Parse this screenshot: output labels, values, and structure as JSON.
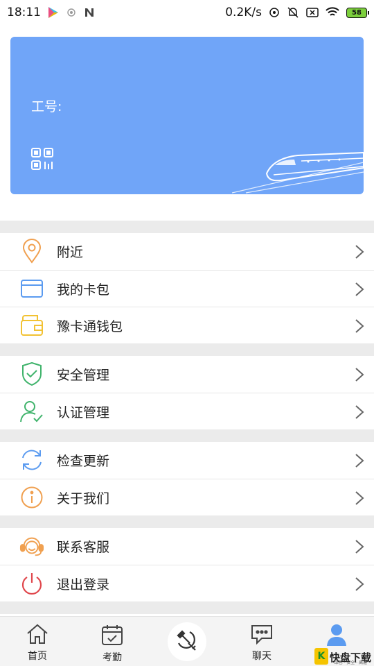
{
  "status_bar": {
    "time": "18:11",
    "speed": "0.2K/s",
    "battery": "58",
    "icons": [
      "play-store-icon",
      "hotspot-icon",
      "n-icon",
      "sync-icon",
      "mute-icon",
      "sim-icon",
      "wifi-icon"
    ]
  },
  "card": {
    "label": "工号:",
    "icons": [
      "qr-code-icon",
      "train-illustration"
    ],
    "color": "#70a5f8"
  },
  "menu": {
    "groups": [
      [
        {
          "label": "附近",
          "icon": "location-pin-icon",
          "color": "#f0a050"
        },
        {
          "label": "我的卡包",
          "icon": "card-icon",
          "color": "#5b9bf0"
        },
        {
          "label": "豫卡通钱包",
          "icon": "wallet-icon",
          "color": "#f2c233"
        }
      ],
      [
        {
          "label": "安全管理",
          "icon": "shield-check-icon",
          "color": "#3fb36b"
        },
        {
          "label": "认证管理",
          "icon": "user-check-icon",
          "color": "#3fb36b"
        }
      ],
      [
        {
          "label": "检查更新",
          "icon": "refresh-icon",
          "color": "#5b9bf0"
        },
        {
          "label": "关于我们",
          "icon": "info-icon",
          "color": "#f0a050"
        }
      ],
      [
        {
          "label": "联系客服",
          "icon": "headset-icon",
          "color": "#f0a050"
        },
        {
          "label": "退出登录",
          "icon": "power-icon",
          "color": "#e0474c"
        }
      ]
    ]
  },
  "bottom_nav": {
    "home": "首页",
    "attendance": "考勤",
    "chat": "聊天",
    "center_icon": "party-emblem-icon",
    "profile_icon": "user-icon",
    "active_color": "#5b9bf0"
  },
  "watermark": {
    "k": "K",
    "text": "快盘下载",
    "sub": "绿色 · 安全 · 高速"
  }
}
